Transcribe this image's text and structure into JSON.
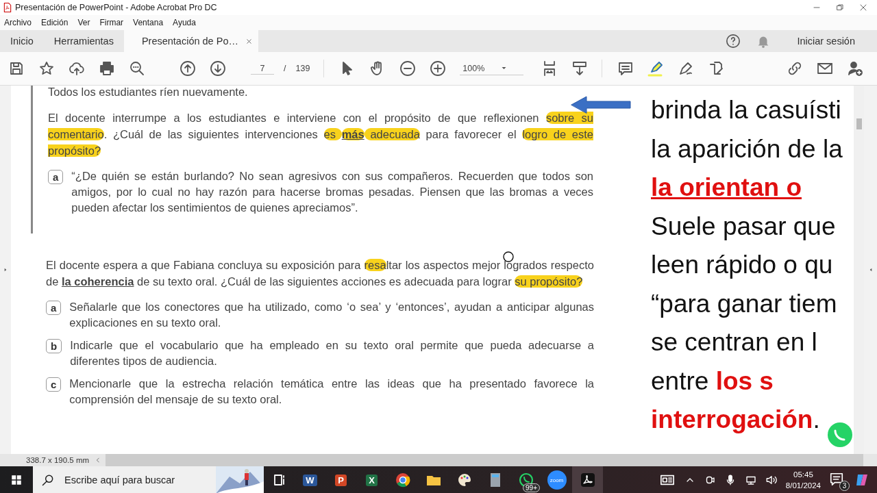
{
  "window": {
    "title": "Presentación de PowerPoint - Adobe Acrobat Pro DC"
  },
  "menu": [
    "Archivo",
    "Edición",
    "Ver",
    "Firmar",
    "Ventana",
    "Ayuda"
  ],
  "tabs": [
    {
      "label": "Inicio",
      "selected": false
    },
    {
      "label": "Herramientas",
      "selected": false
    },
    {
      "label": "Presentación de Po…",
      "selected": true
    }
  ],
  "sign_in": "Iniciar sesión",
  "toolbar": {
    "page": "7",
    "separator": "/",
    "page_count": "139",
    "zoom": "100%"
  },
  "document": {
    "cut_line": "Todos los estudiantes ríen nuevamente.",
    "questions": [
      {
        "paragraph": [
          {
            "text": "El docente interrumpe a los estudiantes e interviene con el propósito de que reflexionen "
          },
          {
            "text": "sobre su comentario",
            "highlight": true
          },
          {
            "text": ". ¿Cuál de las siguientes intervenciones "
          },
          {
            "text": "es ",
            "highlight": true
          },
          {
            "text": "más",
            "highlight": true,
            "strong": true
          },
          {
            "text": " adecuada",
            "highlight": true
          },
          {
            "text": " para favorecer el "
          },
          {
            "text": "logro de este propósito?",
            "highlight": true
          }
        ],
        "options": [
          {
            "letter": "a",
            "text": "“¿De quién se están burlando? No sean agresivos con sus compañeros. Recuerden que todos son amigos, por lo cual no hay razón para hacerse bromas pesadas. Piensen que las bromas a veces pueden afectar los sentimientos de quienes apreciamos”."
          }
        ]
      },
      {
        "paragraph": [
          {
            "text": "El docente espera a que Fabiana concluya su exposición para "
          },
          {
            "text": "resa",
            "highlight": true
          },
          {
            "text": "ltar los aspectos mejor logrados respecto de "
          },
          {
            "text": "la coherencia",
            "strong": true
          },
          {
            "text": " de su texto oral. ¿Cuál de las siguientes acciones es adecuada para lograr "
          },
          {
            "text": "su propósito?",
            "highlight": true
          }
        ],
        "options": [
          {
            "letter": "a",
            "text": "Señalarle que los conectores que ha utilizado, como ‘o sea’ y ‘entonces’, ayudan a anticipar algunas explicaciones en su texto oral."
          },
          {
            "letter": "b",
            "text": "Indicarle que el vocabulario que ha empleado en su texto oral permite que pueda adecuarse a diferentes tipos de audiencia."
          },
          {
            "letter": "c",
            "text": "Mencionarle que la estrecha relación temática entre las ideas que ha presentado favorece la comprensión del mensaje de su texto oral."
          }
        ]
      }
    ],
    "side_lines": [
      [
        {
          "text": "brinda la casuísti"
        }
      ],
      [
        {
          "text": "la aparición de la"
        }
      ],
      [
        {
          "text": "la orientan o",
          "emphasis": true,
          "underline": true
        }
      ],
      [
        {
          "text": "Suele pasar que"
        }
      ],
      [
        {
          "text": "leen rápido o qu"
        }
      ],
      [
        {
          "text": "“para ganar tiem"
        }
      ],
      [
        {
          "text": "se centran en l"
        }
      ],
      [
        {
          "text": "entre "
        },
        {
          "text": "los s",
          "emphasis": true
        }
      ],
      [
        {
          "text": "interrogación",
          "emphasis": true
        },
        {
          "text": "."
        }
      ]
    ]
  },
  "status": {
    "page_size": "338.7 x 190.5 mm"
  },
  "taskbar": {
    "search_placeholder": "Escribe aquí para buscar",
    "apps": [
      {
        "kind": "taskview"
      },
      {
        "kind": "word",
        "glyph": "W"
      },
      {
        "kind": "powerpoint",
        "glyph": "P"
      },
      {
        "kind": "excel",
        "glyph": "X"
      },
      {
        "kind": "chrome"
      },
      {
        "kind": "folder"
      },
      {
        "kind": "paint"
      },
      {
        "kind": "calculator"
      },
      {
        "kind": "whatsapp",
        "badge": "99+"
      },
      {
        "kind": "zoom",
        "glyph": "zoom"
      },
      {
        "kind": "acrobat",
        "selected": true
      }
    ],
    "time": "05:45",
    "date": "8/01/2024",
    "notifications": "3"
  }
}
